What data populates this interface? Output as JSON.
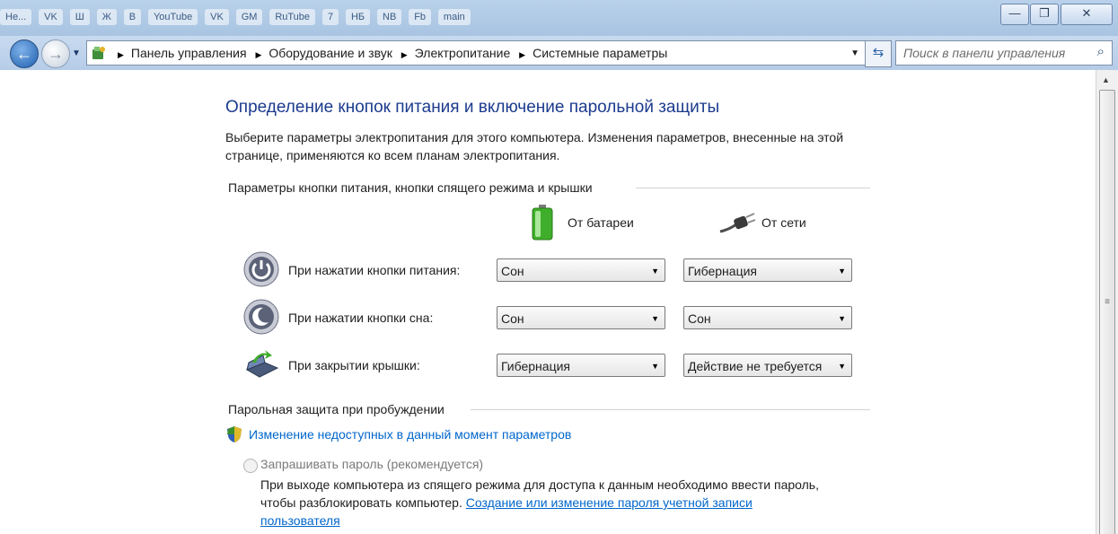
{
  "window": {
    "tabs": [
      "Не...",
      "VK",
      "Ш",
      "Ж",
      "В",
      "YouTube",
      "VK",
      "GM",
      "RuTube",
      "7",
      "НБ",
      "NB",
      "Fb",
      "main"
    ],
    "minimize_glyph": "—",
    "restore_glyph": "❐",
    "close_glyph": "✕"
  },
  "nav": {
    "back_glyph": "←",
    "forward_glyph": "→",
    "dropdown_glyph": "▼",
    "breadcrumbs": [
      "Панель управления",
      "Оборудование и звук",
      "Электропитание",
      "Системные параметры"
    ],
    "breadcrumb_sep": "▶",
    "refresh_glyph": "⇆",
    "search_placeholder": "Поиск в панели управления",
    "search_glyph": "⌕"
  },
  "page": {
    "title": "Определение кнопок питания и включение парольной защиты",
    "description": "Выберите параметры электропитания для этого компьютера. Изменения параметров, внесенные на этой странице, применяются ко всем планам электропитания.",
    "section_buttons": "Параметры кнопки питания, кнопки спящего режима и крышки",
    "col_battery": "От батареи",
    "col_ac": "От сети",
    "rows": [
      {
        "label": "При нажатии кнопки питания:",
        "battery": "Сон",
        "ac": "Гибернация",
        "icon": "power-button-icon"
      },
      {
        "label": "При нажатии кнопки сна:",
        "battery": "Сон",
        "ac": "Сон",
        "icon": "sleep-button-icon"
      },
      {
        "label": "При закрытии крышки:",
        "battery": "Гибернация",
        "ac": "Действие не требуется",
        "icon": "laptop-lid-icon"
      }
    ],
    "dropdown_glyph": "▼",
    "section_password": "Парольная защита при пробуждении",
    "change_link": "Изменение недоступных в данный момент параметров",
    "radio_label": "Запрашивать пароль (рекомендуется)",
    "radio_desc_text": "При выходе компьютера из спящего режима для доступа к данным необходимо ввести пароль, чтобы разблокировать компьютер.",
    "radio_desc_link": "Создание или изменение пароля учетной записи пользователя"
  },
  "scrollbar": {
    "up_glyph": "▲",
    "grip_glyph": "≡"
  },
  "colors": {
    "title_blue": "#1c3b8e",
    "link_blue": "#0066cc",
    "chrome_blue": "#b9d1ea"
  }
}
